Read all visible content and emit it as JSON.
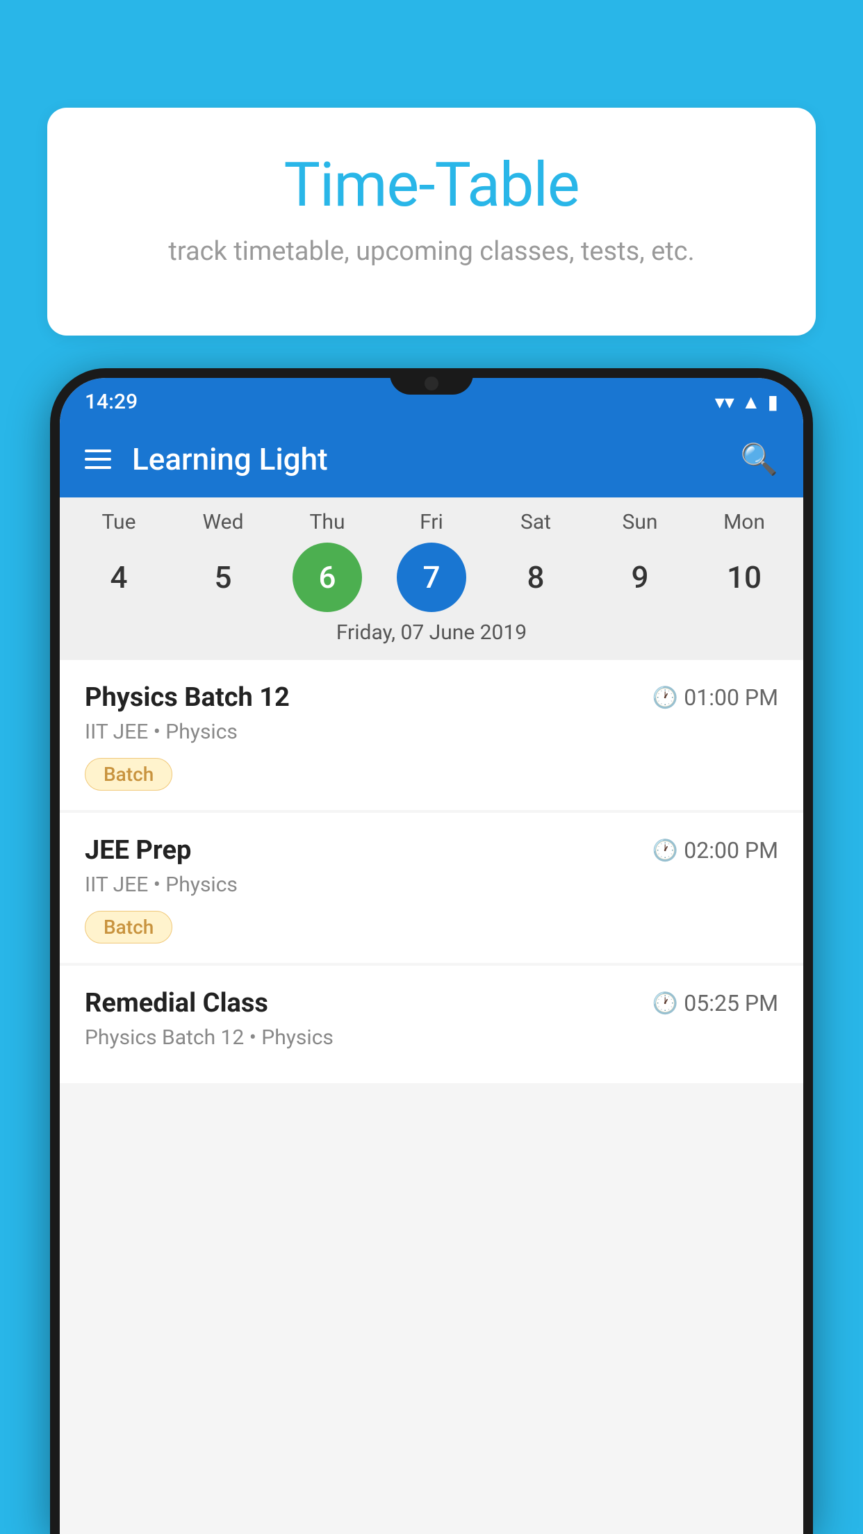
{
  "background_color": "#29b6e8",
  "speech_bubble": {
    "title": "Time-Table",
    "subtitle": "track timetable, upcoming classes, tests, etc."
  },
  "phone": {
    "status_bar": {
      "time": "14:29"
    },
    "app_bar": {
      "title": "Learning Light"
    },
    "calendar": {
      "days": [
        {
          "label": "Tue",
          "number": "4",
          "state": "normal"
        },
        {
          "label": "Wed",
          "number": "5",
          "state": "normal"
        },
        {
          "label": "Thu",
          "number": "6",
          "state": "today"
        },
        {
          "label": "Fri",
          "number": "7",
          "state": "selected"
        },
        {
          "label": "Sat",
          "number": "8",
          "state": "normal"
        },
        {
          "label": "Sun",
          "number": "9",
          "state": "normal"
        },
        {
          "label": "Mon",
          "number": "10",
          "state": "normal"
        }
      ],
      "selected_date_label": "Friday, 07 June 2019"
    },
    "schedule": [
      {
        "title": "Physics Batch 12",
        "time": "01:00 PM",
        "subtitle": "IIT JEE • Physics",
        "badge": "Batch"
      },
      {
        "title": "JEE Prep",
        "time": "02:00 PM",
        "subtitle": "IIT JEE • Physics",
        "badge": "Batch"
      },
      {
        "title": "Remedial Class",
        "time": "05:25 PM",
        "subtitle": "Physics Batch 12 • Physics",
        "badge": null
      }
    ]
  }
}
